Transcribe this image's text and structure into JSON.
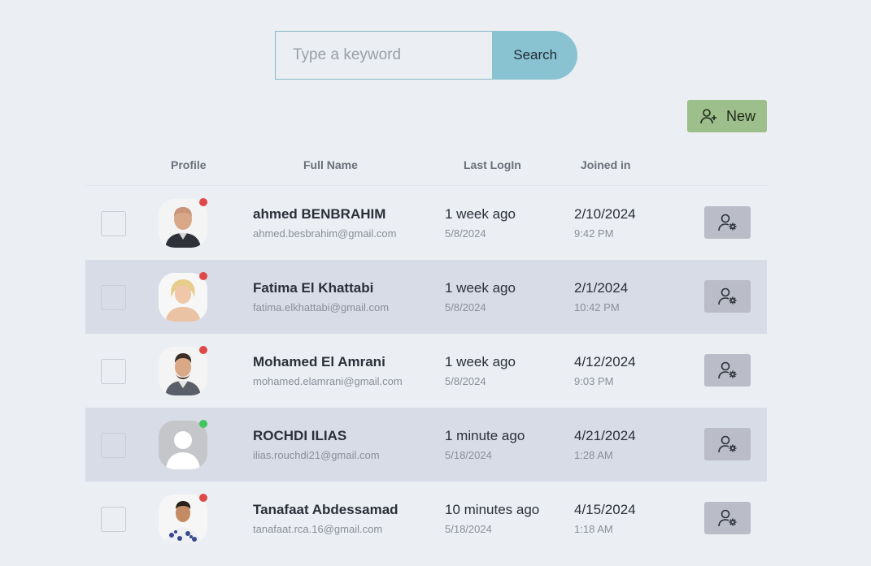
{
  "search": {
    "placeholder": "Type a keyword",
    "button_label": "Search"
  },
  "toolbar": {
    "new_label": "New"
  },
  "table": {
    "headers": {
      "profile": "Profile",
      "full_name": "Full Name",
      "last_login": "Last LogIn",
      "joined_in": "Joined in"
    },
    "rows": [
      {
        "name": "ahmed BENBRAHIM",
        "email": "ahmed.besbrahim@gmail.com",
        "last_login": "1 week ago",
        "last_login_date": "5/8/2024",
        "joined_date": "2/10/2024",
        "joined_time": "9:42 PM",
        "status": "offline",
        "status_color": "#e04848",
        "avatar": "photo-bald-man"
      },
      {
        "name": "Fatima El Khattabi",
        "email": "fatima.elkhattabi@gmail.com",
        "last_login": "1 week ago",
        "last_login_date": "5/8/2024",
        "joined_date": "2/1/2024",
        "joined_time": "10:42 PM",
        "status": "offline",
        "status_color": "#e04848",
        "avatar": "photo-blonde-woman"
      },
      {
        "name": "Mohamed El Amrani",
        "email": "mohamed.elamrani@gmail.com",
        "last_login": "1 week ago",
        "last_login_date": "5/8/2024",
        "joined_date": "4/12/2024",
        "joined_time": "9:03 PM",
        "status": "offline",
        "status_color": "#e04848",
        "avatar": "photo-bearded-man"
      },
      {
        "name": "ROCHDI ILIAS",
        "email": "ilias.rouchdi21@gmail.com",
        "last_login": "1 minute ago",
        "last_login_date": "5/18/2024",
        "joined_date": "4/21/2024",
        "joined_time": "1:28 AM",
        "status": "online",
        "status_color": "#3fc761",
        "avatar": "default-avatar"
      },
      {
        "name": "Tanafaat Abdessamad",
        "email": "tanafaat.rca.16@gmail.com",
        "last_login": "10 minutes ago",
        "last_login_date": "5/18/2024",
        "joined_date": "4/15/2024",
        "joined_time": "1:18 AM",
        "status": "offline",
        "status_color": "#e04848",
        "avatar": "photo-man-patterned-shirt"
      }
    ]
  },
  "colors": {
    "background": "#ebeef3",
    "row_alt": "#d7dce7",
    "search_button": "#89c2d1",
    "new_button": "#9dbf8b",
    "manage_button": "#babdc7"
  }
}
